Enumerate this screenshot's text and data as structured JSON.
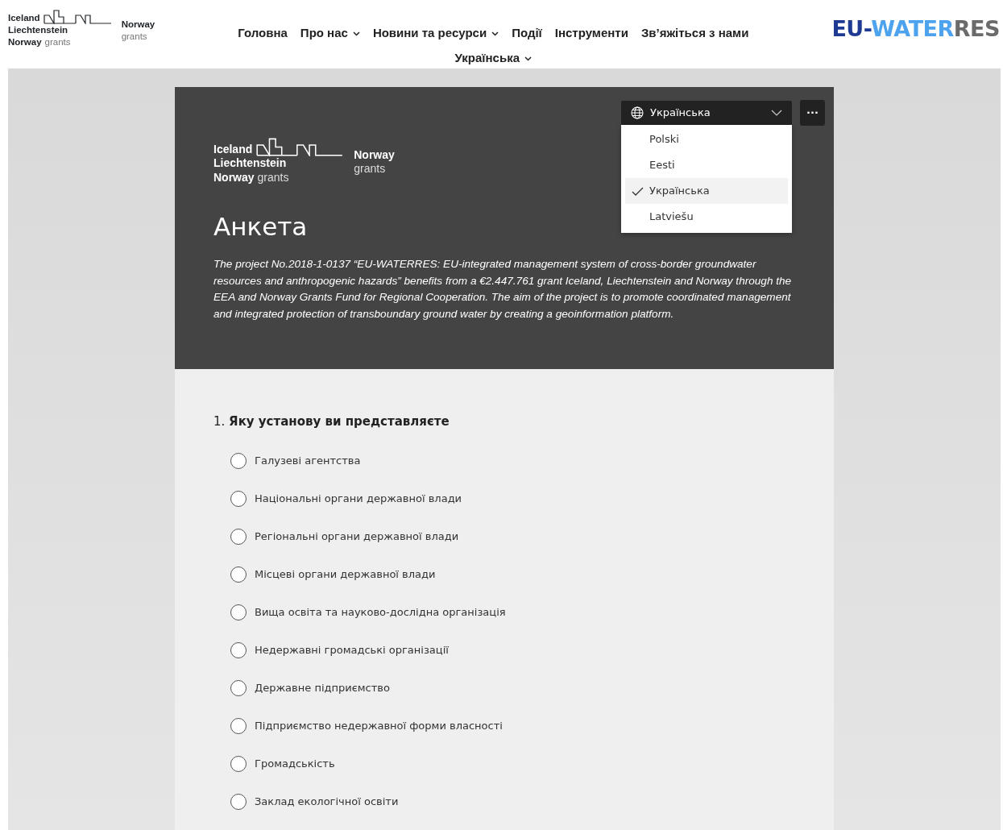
{
  "site_logo": {
    "lines": [
      "Iceland",
      "Liechtenstein",
      "Norway"
    ],
    "grants_word": "grants",
    "right_lines": [
      "Norway",
      "grants"
    ]
  },
  "nav": [
    {
      "label": "Головна",
      "has_menu": false
    },
    {
      "label": "Про нас",
      "has_menu": true
    },
    {
      "label": "Новини та ресурси",
      "has_menu": true
    },
    {
      "label": "Події",
      "has_menu": false
    },
    {
      "label": "Інструменти",
      "has_menu": false
    },
    {
      "label": "Зв’яжіться з нами",
      "has_menu": false
    },
    {
      "label": "Українська",
      "has_menu": true
    }
  ],
  "brand": {
    "parts": [
      {
        "text": "EU-",
        "color": "#1f3a93"
      },
      {
        "text": "WATER",
        "color": "#4ea3ef"
      },
      {
        "text": "RES",
        "color": "#6b6b6b"
      }
    ]
  },
  "form": {
    "logo": {
      "lines": [
        "Iceland",
        "Liechtenstein",
        "Norway"
      ],
      "grants_word": "grants",
      "right_lines": [
        "Norway",
        "grants"
      ]
    },
    "title": "Анкета",
    "description": "The project No.2018-1-0137 “EU-WATERRES: EU-integrated management system of cross-border groundwater resources and anthropogenic hazards” benefits from a €2.447.761 grant Iceland, Liechtenstein and Norway through the EEA and Norway Grants Fund for Regional Cooperation. The aim of the project is to promote coordinated management and integrated protection of transboundary ground water by creating a geoinformation platform.",
    "language_select": {
      "value": "Українська",
      "expanded": true,
      "options": [
        {
          "label": "Polski",
          "selected": false
        },
        {
          "label": "Eesti",
          "selected": false
        },
        {
          "label": "Українська",
          "selected": true
        },
        {
          "label": "Latviešu",
          "selected": false
        }
      ]
    },
    "more_button": "···",
    "questions": [
      {
        "number": "1.",
        "text": "Яку установу ви представляєте",
        "options": [
          {
            "label": "Галузеві агентства",
            "selected": false
          },
          {
            "label": "Національні органи державної влади",
            "selected": false
          },
          {
            "label": "Регіональні органи державної влади",
            "selected": false
          },
          {
            "label": "Місцеві органи державної влади",
            "selected": false
          },
          {
            "label": "Вища освіта та науково-дослідна організація",
            "selected": false
          },
          {
            "label": "Недержавні громадські організації",
            "selected": false
          },
          {
            "label": "Державне підприємство",
            "selected": false
          },
          {
            "label": "Підприємство недержавної форми власності",
            "selected": false
          },
          {
            "label": "Громадськість",
            "selected": false
          },
          {
            "label": "Заклад екологічної освіти",
            "selected": false
          }
        ]
      }
    ]
  }
}
